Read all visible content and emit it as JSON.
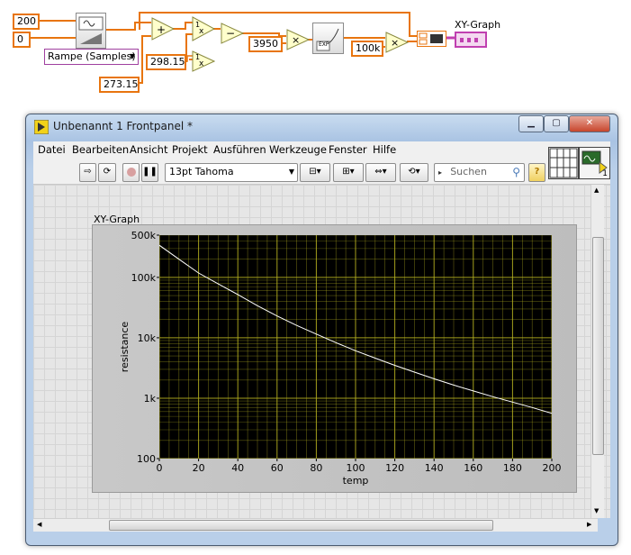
{
  "block_diagram": {
    "const_200": "200",
    "const_0": "0",
    "ramp_select": "Rampe (Samples)",
    "const_298": "298.15",
    "const_273": "273.15",
    "const_3950": "3950",
    "const_100k": "100k",
    "exp_label": "EXP",
    "xy_graph_terminal": "XY-Graph"
  },
  "window": {
    "title": "Unbenannt 1 Frontpanel *",
    "menu": [
      "Datei",
      "Bearbeiten",
      "Ansicht",
      "Projekt",
      "Ausführen",
      "Werkzeuge",
      "Fenster",
      "Hilfe"
    ],
    "font_select": "13pt Tahoma",
    "search_placeholder": "Suchen",
    "help_label": "?",
    "vi_icon_number": "1"
  },
  "graph": {
    "label": "XY-Graph"
  },
  "chart_data": {
    "type": "line",
    "xlabel": "temp",
    "ylabel": "resistance",
    "xlim": [
      0,
      200
    ],
    "ylim": [
      100,
      500000
    ],
    "yscale": "log",
    "x_ticks": [
      "0",
      "20",
      "40",
      "60",
      "80",
      "100",
      "120",
      "140",
      "160",
      "180",
      "200"
    ],
    "y_ticks": [
      "500k",
      "100k",
      "10k",
      "1k",
      "100"
    ],
    "series": [
      {
        "color": "#ffffff",
        "x": [
          0,
          10,
          20,
          30,
          40,
          50,
          60,
          70,
          80,
          90,
          100,
          110,
          120,
          130,
          140,
          150,
          160,
          170,
          180,
          190,
          200
        ],
        "y": [
          340000,
          200000,
          118000,
          78000,
          52000,
          34000,
          23000,
          16000,
          11500,
          8300,
          6100,
          4600,
          3500,
          2700,
          2100,
          1650,
          1320,
          1060,
          860,
          700,
          560
        ]
      }
    ],
    "grid": true,
    "grid_color": "#b5b020"
  }
}
